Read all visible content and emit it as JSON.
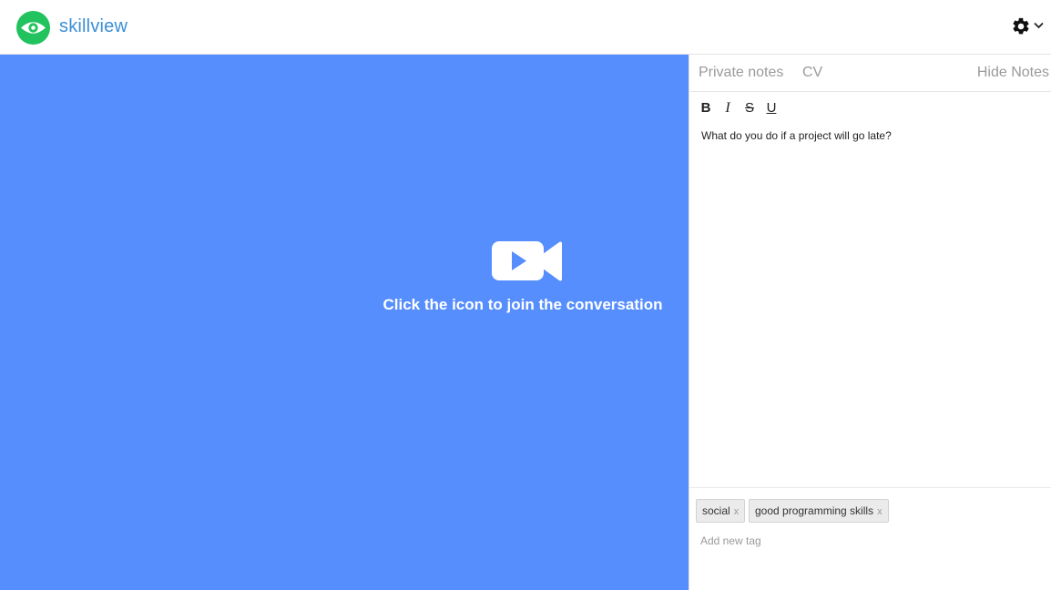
{
  "header": {
    "brand": "skillview",
    "brand_color": "#3a8fd6",
    "logo_color": "#22c25e",
    "settings_icon": "gear-icon"
  },
  "video": {
    "background": "#578efe",
    "join_icon": "video-camera-icon",
    "join_text": "Click the icon to join the conversation"
  },
  "notes": {
    "tabs": [
      {
        "label": "Private notes"
      },
      {
        "label": "CV"
      },
      {
        "label": "Hide Notes"
      }
    ],
    "toolbar": {
      "bold": "B",
      "italic": "I",
      "strike": "S",
      "underline": "U"
    },
    "content": "What do you do if a project will go late?",
    "tags": [
      {
        "label": "social",
        "remove": "x"
      },
      {
        "label": "good programming skills",
        "remove": "x"
      }
    ],
    "new_tag_placeholder": "Add new tag"
  }
}
